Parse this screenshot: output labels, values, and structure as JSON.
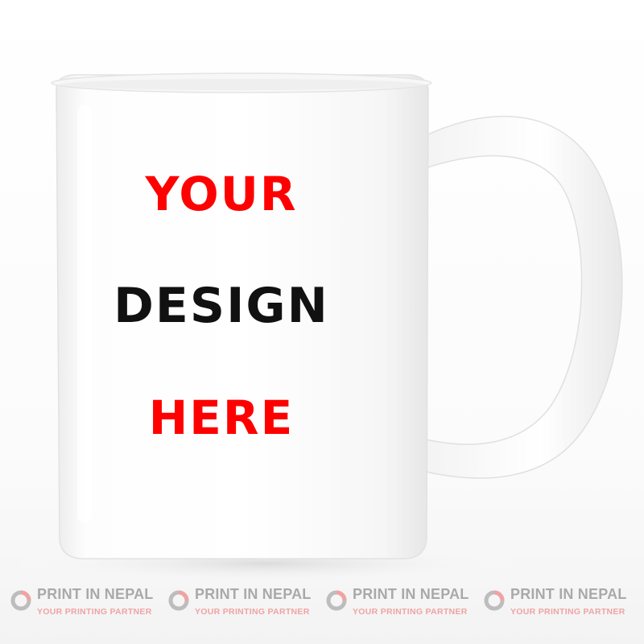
{
  "mug": {
    "body_color": "#ffffff",
    "design_text": {
      "line1": "YOUR",
      "line2": "DESIGN",
      "line3": "HERE"
    },
    "design_colors": {
      "line1": "#ff0000",
      "line2": "#111111",
      "line3": "#ff0000"
    }
  },
  "watermarks": [
    {
      "name": "PRINT IN NEPAL",
      "tagline": "YOUR PRINTING PARTNER",
      "icon": "print-in-nepal-logo-icon"
    },
    {
      "name": "PRINT IN NEPAL",
      "tagline": "YOUR PRINTING PARTNER",
      "icon": "print-in-nepal-logo-icon"
    },
    {
      "name": "PRINT IN NEPAL",
      "tagline": "YOUR PRINTING PARTNER",
      "icon": "print-in-nepal-logo-icon"
    },
    {
      "name": "PRINT IN NEPAL",
      "tagline": "YOUR PRINTING PARTNER",
      "icon": "print-in-nepal-logo-icon"
    }
  ]
}
